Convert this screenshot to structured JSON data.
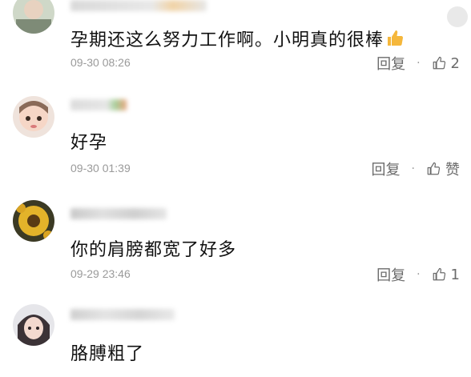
{
  "comments": [
    {
      "content": "孕期还这么努力工作啊。小明真的很棒",
      "time": "09-30 08:26",
      "reply_label": "回复",
      "separator": "·",
      "likes": "2"
    },
    {
      "content": "好孕",
      "time": "09-30 01:39",
      "reply_label": "回复",
      "separator": "·",
      "likes": "赞"
    },
    {
      "content": "你的肩膀都宽了好多",
      "time": "09-29 23:46",
      "reply_label": "回复",
      "separator": "·",
      "likes": "1"
    },
    {
      "content": "胳膊粗了"
    }
  ],
  "colors": {
    "text": "#111111",
    "meta": "#9a9a9a",
    "action": "#6b6b6b",
    "thumb_emoji": "#f5b73b"
  }
}
